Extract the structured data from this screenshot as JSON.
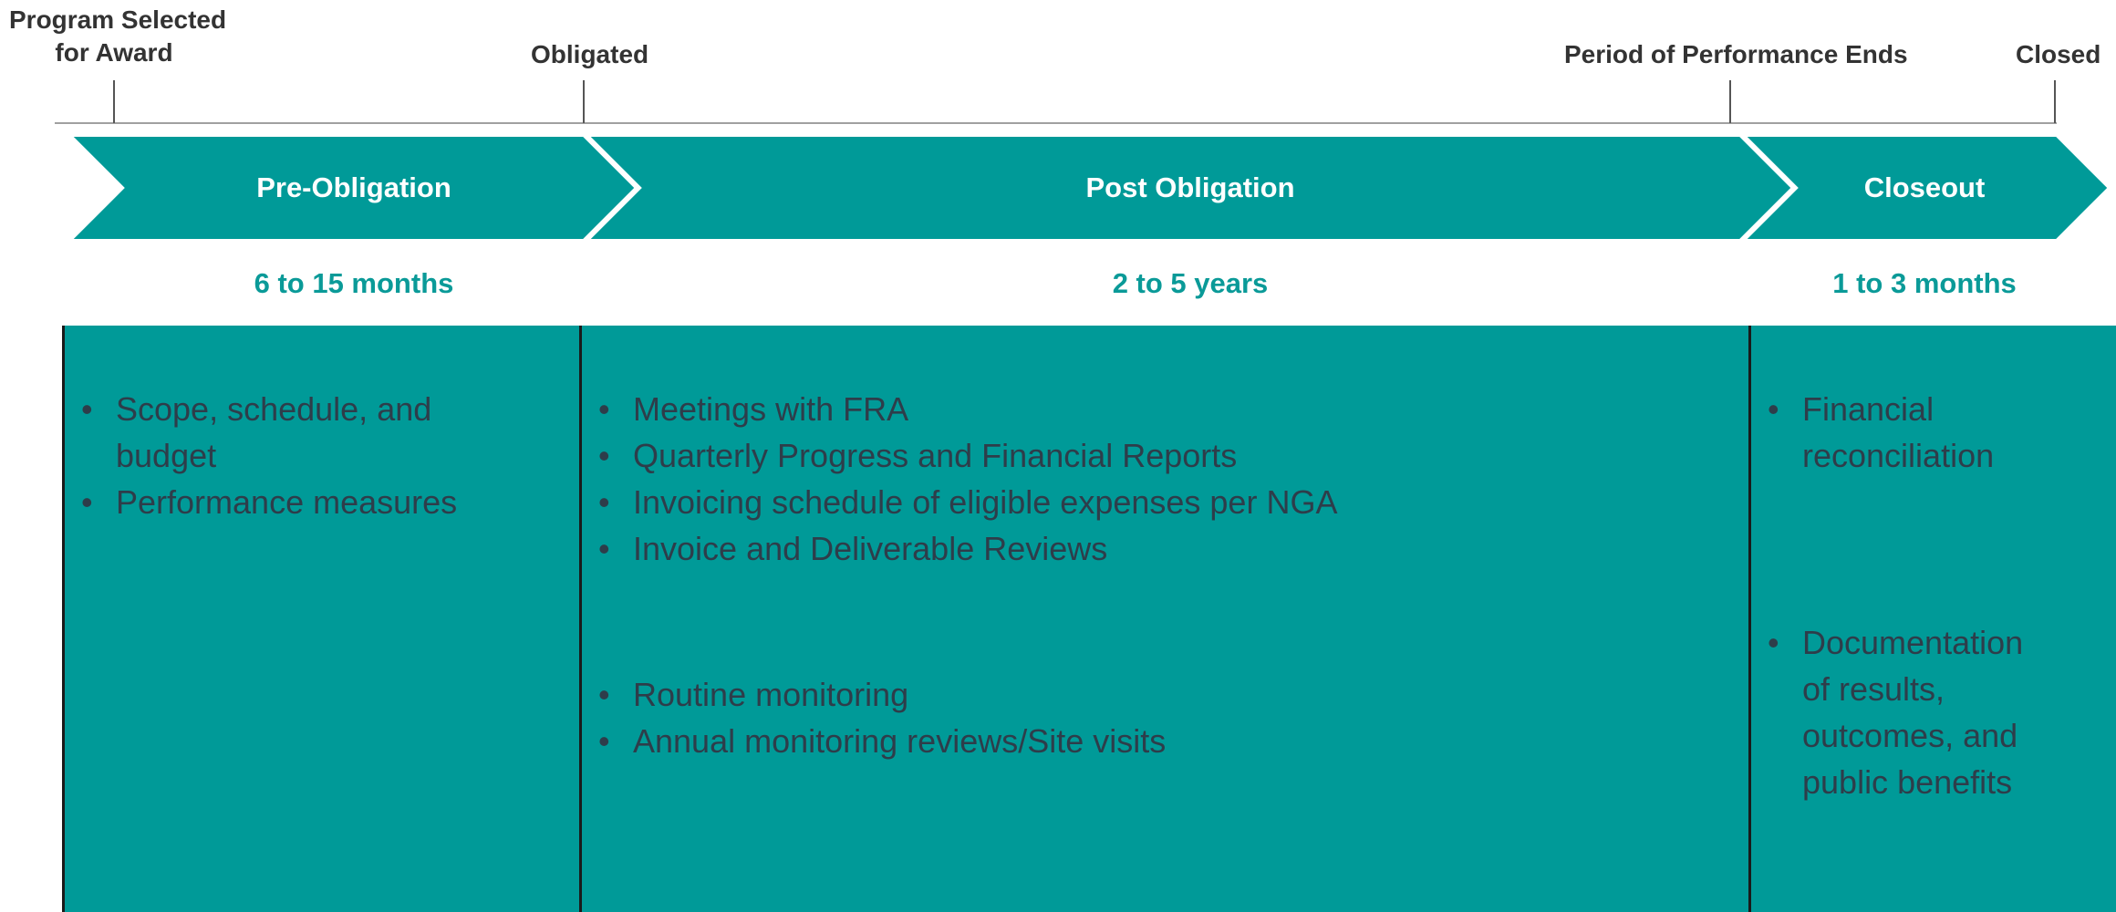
{
  "milestones": {
    "selected_line1": "Program Selected",
    "selected_line2": "for Award",
    "obligated": "Obligated",
    "pop_ends": "Period of Performance Ends",
    "closed": "Closed"
  },
  "phases": [
    {
      "label": "Pre-Obligation",
      "duration": "6 to 15 months"
    },
    {
      "label": "Post Obligation",
      "duration": "2 to 5 years"
    },
    {
      "label": "Closeout",
      "duration": "1 to 3 months"
    }
  ],
  "pre_obligation": {
    "items": [
      "Scope, schedule, and budget",
      "Performance measures"
    ]
  },
  "post_obligation": {
    "group1": [
      "Meetings with FRA",
      "Quarterly Progress and Financial Reports",
      "Invoicing schedule of eligible expenses per NGA",
      "Invoice and Deliverable Reviews"
    ],
    "group2": [
      "Routine monitoring",
      "Annual monitoring reviews/Site visits"
    ]
  },
  "closeout": {
    "group1": [
      "Financial reconciliation"
    ],
    "group2": [
      "Documentation of results, outcomes, and public benefits"
    ]
  },
  "colors": {
    "teal": "#009a98",
    "text_dark": "#2e3d4a",
    "duration_text": "#0a9a98"
  }
}
